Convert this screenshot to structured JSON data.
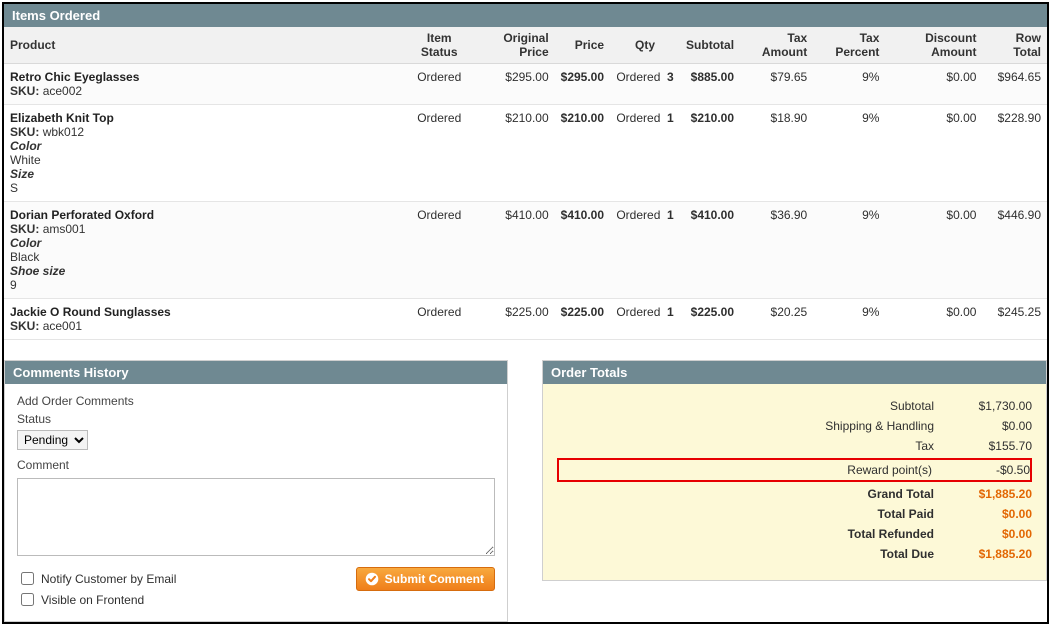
{
  "items_panel": {
    "title": "Items Ordered"
  },
  "columns": {
    "product": "Product",
    "item_status": "Item Status",
    "original_price": "Original Price",
    "price": "Price",
    "qty": "Qty",
    "subtotal": "Subtotal",
    "tax_amount": "Tax Amount",
    "tax_percent": "Tax Percent",
    "discount_amount": "Discount Amount",
    "row_total": "Row Total"
  },
  "sku_label": "SKU:",
  "items": [
    {
      "name": "Retro Chic Eyeglasses",
      "sku": "ace002",
      "options": [],
      "status": "Ordered",
      "original_price": "$295.00",
      "price": "$295.00",
      "qty_label": "Ordered",
      "qty": "3",
      "subtotal": "$885.00",
      "tax_amount": "$79.65",
      "tax_percent": "9%",
      "discount": "$0.00",
      "row_total": "$964.65"
    },
    {
      "name": "Elizabeth Knit Top",
      "sku": "wbk012",
      "options": [
        {
          "label": "Color",
          "value": "White"
        },
        {
          "label": "Size",
          "value": "S"
        }
      ],
      "status": "Ordered",
      "original_price": "$210.00",
      "price": "$210.00",
      "qty_label": "Ordered",
      "qty": "1",
      "subtotal": "$210.00",
      "tax_amount": "$18.90",
      "tax_percent": "9%",
      "discount": "$0.00",
      "row_total": "$228.90"
    },
    {
      "name": "Dorian Perforated Oxford",
      "sku": "ams001",
      "options": [
        {
          "label": "Color",
          "value": "Black"
        },
        {
          "label": "Shoe size",
          "value": "9"
        }
      ],
      "status": "Ordered",
      "original_price": "$410.00",
      "price": "$410.00",
      "qty_label": "Ordered",
      "qty": "1",
      "subtotal": "$410.00",
      "tax_amount": "$36.90",
      "tax_percent": "9%",
      "discount": "$0.00",
      "row_total": "$446.90"
    },
    {
      "name": "Jackie O Round Sunglasses",
      "sku": "ace001",
      "options": [],
      "status": "Ordered",
      "original_price": "$225.00",
      "price": "$225.00",
      "qty_label": "Ordered",
      "qty": "1",
      "subtotal": "$225.00",
      "tax_amount": "$20.25",
      "tax_percent": "9%",
      "discount": "$0.00",
      "row_total": "$245.25"
    }
  ],
  "comments": {
    "title": "Comments History",
    "add_label": "Add Order Comments",
    "status_label": "Status",
    "status_value": "Pending",
    "comment_label": "Comment",
    "notify_label": "Notify Customer by Email",
    "visible_label": "Visible on Frontend",
    "submit_label": "Submit Comment"
  },
  "totals": {
    "title": "Order Totals",
    "rows": [
      {
        "label": "Subtotal",
        "value": "$1,730.00",
        "bold": false,
        "orange": false,
        "highlight": false
      },
      {
        "label": "Shipping & Handling",
        "value": "$0.00",
        "bold": false,
        "orange": false,
        "highlight": false
      },
      {
        "label": "Tax",
        "value": "$155.70",
        "bold": false,
        "orange": false,
        "highlight": false
      },
      {
        "label": "Reward point(s)",
        "value": "-$0.50",
        "bold": false,
        "orange": false,
        "highlight": true
      },
      {
        "label": "Grand Total",
        "value": "$1,885.20",
        "bold": true,
        "orange": true,
        "highlight": false
      },
      {
        "label": "Total Paid",
        "value": "$0.00",
        "bold": true,
        "orange": true,
        "highlight": false
      },
      {
        "label": "Total Refunded",
        "value": "$0.00",
        "bold": true,
        "orange": true,
        "highlight": false
      },
      {
        "label": "Total Due",
        "value": "$1,885.20",
        "bold": true,
        "orange": true,
        "highlight": false
      }
    ]
  }
}
